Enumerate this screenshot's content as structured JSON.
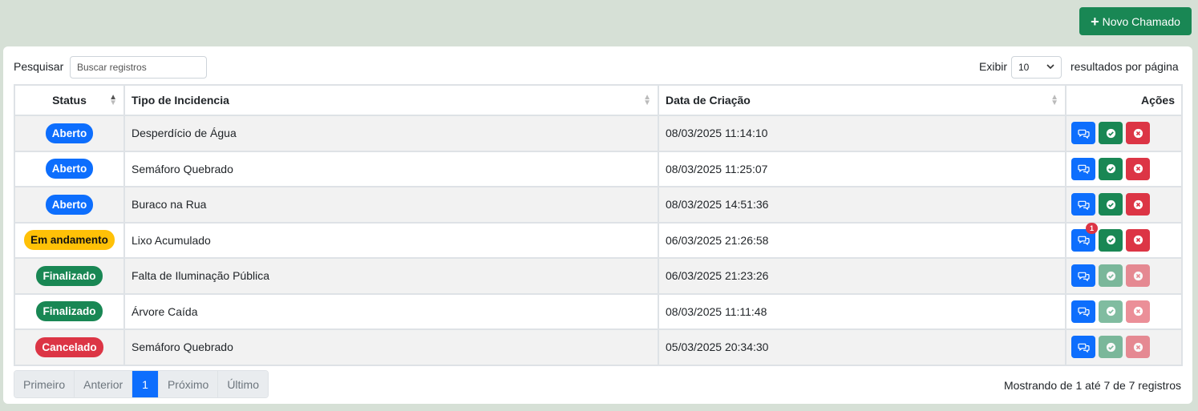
{
  "header": {
    "new_button_label": "Novo Chamado"
  },
  "controls": {
    "search_label": "Pesquisar",
    "search_placeholder": "Buscar registros",
    "show_label": "Exibir",
    "page_size": "10",
    "per_page_label": "resultados por página"
  },
  "table": {
    "columns": [
      "Status",
      "Tipo de Incidencia",
      "Data de Criação",
      "Ações"
    ],
    "rows": [
      {
        "status": "Aberto",
        "tipo": "Desperdício de Água",
        "data": "08/03/2025 11:14:10"
      },
      {
        "status": "Aberto",
        "tipo": "Semáforo Quebrado",
        "data": "08/03/2025 11:25:07"
      },
      {
        "status": "Aberto",
        "tipo": "Buraco na Rua",
        "data": "08/03/2025 14:51:36"
      },
      {
        "status": "Em andamento",
        "tipo": "Lixo Acumulado",
        "data": "06/03/2025 21:26:58",
        "notif": "1"
      },
      {
        "status": "Finalizado",
        "tipo": "Falta de Iluminação Pública",
        "data": "06/03/2025 21:23:26"
      },
      {
        "status": "Finalizado",
        "tipo": "Árvore Caída",
        "data": "08/03/2025 11:11:48"
      },
      {
        "status": "Cancelado",
        "tipo": "Semáforo Quebrado",
        "data": "05/03/2025 20:34:30"
      }
    ]
  },
  "colors": {
    "aberto": "#0d6efd",
    "em_andamento": "#ffc107",
    "finalizado": "#198754",
    "cancelado": "#dc3545"
  },
  "pagination": {
    "first": "Primeiro",
    "previous": "Anterior",
    "current": "1",
    "next": "Próximo",
    "last": "Último"
  },
  "footer": {
    "info": "Mostrando de 1 até 7 de 7 registros"
  }
}
